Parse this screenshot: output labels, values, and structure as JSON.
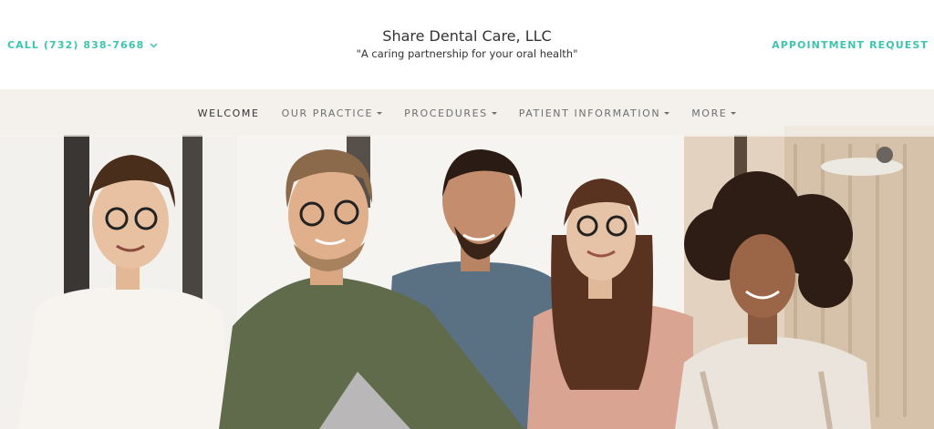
{
  "header": {
    "call_label": "CALL (732) 838-7668",
    "practice_name": "Share Dental Care, LLC",
    "tagline": "\"A caring partnership for your oral health\"",
    "appointment_label": "APPOINTMENT REQUEST"
  },
  "nav": {
    "items": [
      {
        "label": "WELCOME",
        "active": true,
        "has_dropdown": false
      },
      {
        "label": "OUR PRACTICE",
        "active": false,
        "has_dropdown": true
      },
      {
        "label": "PROCEDURES",
        "active": false,
        "has_dropdown": true
      },
      {
        "label": "PATIENT INFORMATION",
        "active": false,
        "has_dropdown": true
      },
      {
        "label": "MORE",
        "active": false,
        "has_dropdown": true
      }
    ]
  },
  "colors": {
    "accent": "#3fc4b0",
    "text": "#333333",
    "nav_text": "#6f6f6f"
  },
  "icons": {
    "call_dropdown": "chevron-down-icon",
    "nav_dropdown": "caret-down-icon"
  }
}
